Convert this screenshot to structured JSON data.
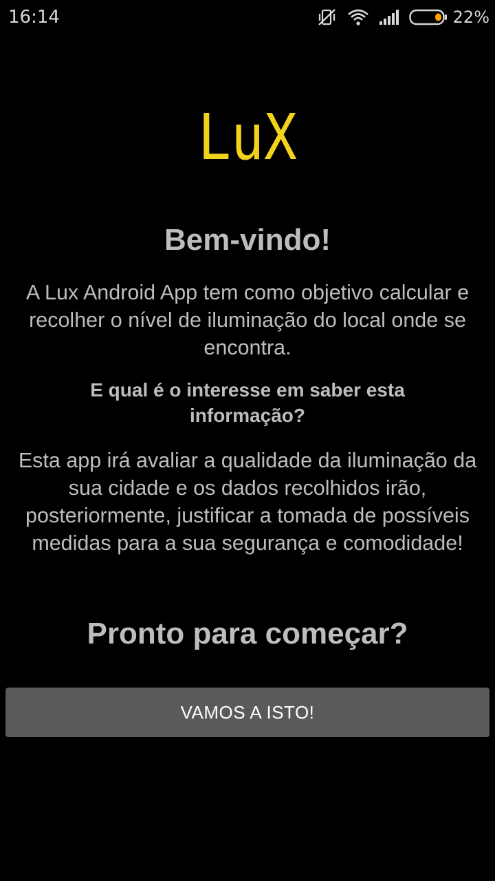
{
  "status_bar": {
    "time": "16:14",
    "battery_percent": "22%",
    "icons": [
      "vibrate-off-icon",
      "wifi-icon",
      "signal-icon",
      "battery-icon"
    ],
    "battery_color": "#ffa000"
  },
  "logo": {
    "text": "LuX",
    "color": "#f2d21a"
  },
  "welcome": {
    "title": "Bem-vindo!",
    "intro": "A Lux Android App tem como objetivo calcular e recolher o nível de iluminação do local onde se encontra.",
    "question": "E qual é o interesse em saber esta informação?",
    "answer": "Esta app irá avaliar a qualidade da iluminação da sua cidade e os dados recolhidos irão, posteriormente, justificar a tomada de possíveis medidas para a sua segurança e comodidade!",
    "ready": "Pronto para começar?"
  },
  "actions": {
    "start_label": "VAMOS A ISTO!"
  },
  "colors": {
    "background": "#000000",
    "text": "#bdbdbd",
    "button": "#5a5a5a",
    "button_text": "#ffffff"
  }
}
